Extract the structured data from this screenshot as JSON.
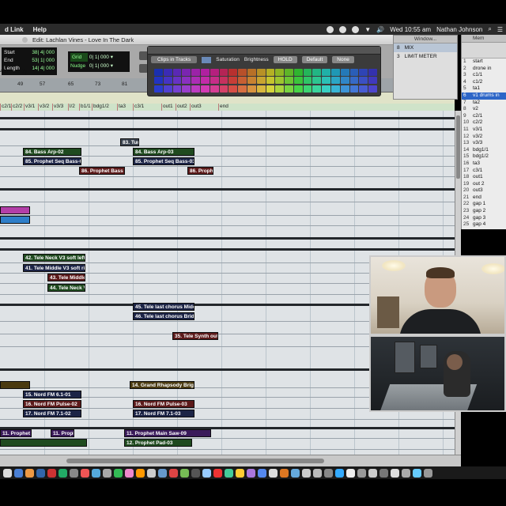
{
  "menubar": {
    "app_partial": "d Link",
    "help": "Help",
    "clock": "Wed 10:55 am",
    "user": "Nathan Johnson"
  },
  "edit_window": {
    "title": "Edit: Lachlan Vines - Love In The Dark"
  },
  "counters": {
    "start_label": "Start",
    "start_value": "38| 4| 000",
    "end_label": "End",
    "end_value": "53| 1| 000",
    "length_label": "Length",
    "length_value": "14| 4| 000",
    "bpm_partial": "450",
    "dly_label": "Dly"
  },
  "grid_nudge": {
    "grid_label": "Grid",
    "grid_value": "0| 1| 000",
    "nudge_label": "Nudge",
    "nudge_value": "0| 1| 000"
  },
  "ruler": {
    "ticks": [
      "49",
      "57",
      "65",
      "73",
      "81"
    ]
  },
  "markers": [
    "c2/1",
    "c2/2",
    "v3/1",
    "v3/2",
    "v3/3",
    "l/2",
    "b1/1",
    "bdg1/2",
    "ta3",
    "c3/1",
    "out1",
    "out2",
    "out3",
    "end"
  ],
  "palette": {
    "clips_in_tracks": "Clips in Tracks",
    "saturation": "Saturation",
    "brightness": "Brightness",
    "hold": "HOLD",
    "default": "Default",
    "none": "None",
    "colors": [
      "#1a2fb0",
      "#3b2bb5",
      "#5a28b5",
      "#7a25b0",
      "#9b22a8",
      "#b020a0",
      "#b51f7e",
      "#b52455",
      "#b8302f",
      "#b8502a",
      "#b87027",
      "#b89126",
      "#b5b024",
      "#8fb524",
      "#5fb528",
      "#2fb52f",
      "#24b55a",
      "#22b584",
      "#20b0a8",
      "#1f98b5",
      "#2479b8",
      "#2a5eb8",
      "#2e44b5",
      "#3431ae",
      "#2233c2",
      "#4533c4",
      "#6732c4",
      "#8a30bf",
      "#ab2db5",
      "#c22ba8",
      "#c62d88",
      "#c6315e",
      "#c73e37",
      "#c75f33",
      "#c88231",
      "#c8a430",
      "#c5c42e",
      "#9dc52f",
      "#6cc533",
      "#3bc53b",
      "#2fc566",
      "#2dc590",
      "#2bc0b6",
      "#2ba6c5",
      "#3086c7",
      "#366ac7",
      "#3b50c4",
      "#4039bd",
      "#2a3cd0",
      "#5040d2",
      "#7540d2",
      "#9a3ecc",
      "#bd3bc2",
      "#d33ab4",
      "#d63d94",
      "#d64168",
      "#d74e45",
      "#d76f41",
      "#d8933f",
      "#d8b73e",
      "#d5d43c",
      "#abd53d",
      "#79d541",
      "#47d547",
      "#3cd572",
      "#3ad59d",
      "#38d0c3",
      "#38b5d5",
      "#3d94d7",
      "#4377d7",
      "#485cd4",
      "#4d45cd"
    ]
  },
  "window_panel": {
    "title": "Window...",
    "rows": [
      {
        "num": "8",
        "name": "MIX"
      },
      {
        "num": "3",
        "name": "LIMIT METER"
      }
    ]
  },
  "memory_panel": {
    "title": "Mem",
    "rows": [
      {
        "num": "1",
        "name": "start"
      },
      {
        "num": "2",
        "name": "drone in"
      },
      {
        "num": "3",
        "name": "c1/1"
      },
      {
        "num": "4",
        "name": "c1/2"
      },
      {
        "num": "5",
        "name": "ta1"
      },
      {
        "num": "6",
        "name": "v1 drums in"
      },
      {
        "num": "7",
        "name": "ta2"
      },
      {
        "num": "8",
        "name": "v2"
      },
      {
        "num": "9",
        "name": "c2/1"
      },
      {
        "num": "10",
        "name": "c2/2"
      },
      {
        "num": "11",
        "name": "v3/1"
      },
      {
        "num": "12",
        "name": "v3/2"
      },
      {
        "num": "13",
        "name": "v3/3"
      },
      {
        "num": "14",
        "name": "bdg1/1"
      },
      {
        "num": "15",
        "name": "bdg1/2"
      },
      {
        "num": "16",
        "name": "ta3"
      },
      {
        "num": "17",
        "name": "c3/1"
      },
      {
        "num": "18",
        "name": "out1"
      },
      {
        "num": "19",
        "name": "out 2"
      },
      {
        "num": "20",
        "name": "out3"
      },
      {
        "num": "21",
        "name": "end"
      },
      {
        "num": "22",
        "name": "gap 1"
      },
      {
        "num": "23",
        "name": "gap 2"
      },
      {
        "num": "24",
        "name": "gap 3"
      },
      {
        "num": "25",
        "name": "gap 4"
      }
    ],
    "selected_index": 5
  },
  "clips": [
    {
      "label": "83. Tun",
      "color": "gray"
    },
    {
      "label": "84. Bass Arp-02",
      "color": "green"
    },
    {
      "label": "84. Bass Arp-03",
      "color": "green"
    },
    {
      "label": "85. Prophet Seq Bass-02.L",
      "color": "navy"
    },
    {
      "label": "85. Prophet Seq Bass-03.L",
      "color": "navy"
    },
    {
      "label": "86. Prophet Bass (no",
      "color": "maroon"
    },
    {
      "label": "86. Prophet",
      "color": "maroon"
    },
    {
      "label": "",
      "color": "magenta"
    },
    {
      "label": "",
      "color": "blue"
    },
    {
      "label": "42. Tele Neck V3 soft left-01.L",
      "color": "green"
    },
    {
      "label": "41. Tele Middle V3 soft right-(",
      "color": "navy"
    },
    {
      "label": "43. Tele Middle V",
      "color": "maroon"
    },
    {
      "label": "44. Tele Neck V3",
      "color": "green"
    },
    {
      "label": "45. Tele last chorus Middle (s",
      "color": "navy"
    },
    {
      "label": "46. Tele last chorus Bridge (s",
      "color": "navy"
    },
    {
      "label": "35. Tele Synth outro-(",
      "color": "maroon"
    },
    {
      "label": "",
      "color": "brown"
    },
    {
      "label": "14. Grand Rhapsody Bright-03",
      "color": "brown"
    },
    {
      "label": "15. Nord FM 6.1-01",
      "color": "navy"
    },
    {
      "label": "16. Nord FM Pulse-02",
      "color": "maroon"
    },
    {
      "label": "16. Nord FM Pulse-03",
      "color": "maroon"
    },
    {
      "label": "17. Nord FM 7.1-02",
      "color": "navy"
    },
    {
      "label": "17. Nord FM 7.1-03",
      "color": "navy"
    },
    {
      "label": "11. Prophet Main",
      "color": "purple"
    },
    {
      "label": "11. Proph",
      "color": "purple"
    },
    {
      "label": "11. Prophet Main Saw-09",
      "color": "purple"
    },
    {
      "label": "",
      "color": "green"
    },
    {
      "label": "12. Prophet Pad-03",
      "color": "green"
    }
  ]
}
